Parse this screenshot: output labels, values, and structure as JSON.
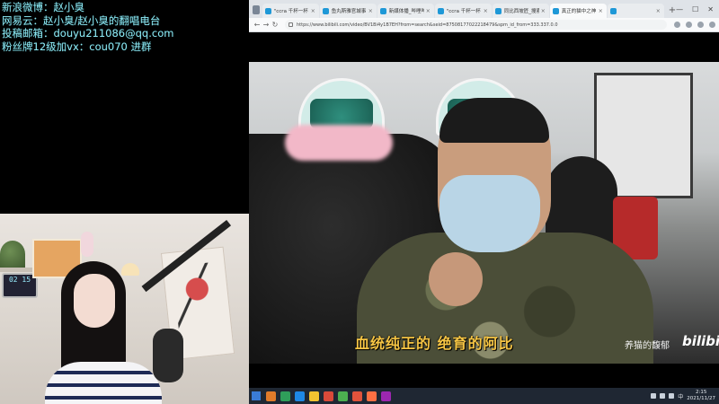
{
  "info": {
    "weibo": "新浪微博：赵小臭",
    "netease": "网易云：赵小臭/赵小臭的翻唱电台",
    "email": "投稿邮箱：douyu211086@qq.com",
    "fanclub": "粉丝牌12级加vx：cou070 进群"
  },
  "webcam": {
    "clock_text": "02 15"
  },
  "browser": {
    "tabs": [
      {
        "title": "\"ccra 千杯一杯 — 哔哩哔哩",
        "fav": "blue",
        "active": false
      },
      {
        "title": "鱼丸斯雅官城事",
        "fav": "blue",
        "active": false
      },
      {
        "title": "新媒体播_哔哩哔哩",
        "fav": "blue",
        "active": false
      },
      {
        "title": "\"ccra 千杯一杯 — 哔哩",
        "fav": "blue",
        "active": false
      },
      {
        "title": "同比西坡匠_搜索结果_哔哩哔哩",
        "fav": "blue",
        "active": false
      },
      {
        "title": "真正的猫中之神！世界第一",
        "fav": "blue",
        "active": true
      },
      {
        "title": "",
        "fav": "blue",
        "active": false
      }
    ],
    "new_tab": "+",
    "window_controls": {
      "minimize": "—",
      "maximize": "☐",
      "close": "✕"
    },
    "nav": {
      "back": "←",
      "forward": "→",
      "refresh": "↻"
    },
    "url": "https://www.bilibili.com/video/BV1Bi4y1B7EH?from=search&seid=87508177022218479&spm_id_from=333.337.0.0"
  },
  "video": {
    "subtitle": "血统纯正的  绝育的阿比",
    "uploader_watermark": "养猫的馥郁",
    "platform_logo": "bilibili"
  },
  "taskbar": {
    "apps": [
      "#e07b2a",
      "#2f9e5a",
      "#1e88e5",
      "#f2c230",
      "#d94a3a",
      "#4caf50",
      "#e0533c",
      "#ff7043",
      "#9c27b0"
    ],
    "time": "2:15",
    "date": "2021/11/27",
    "ime": "中"
  }
}
